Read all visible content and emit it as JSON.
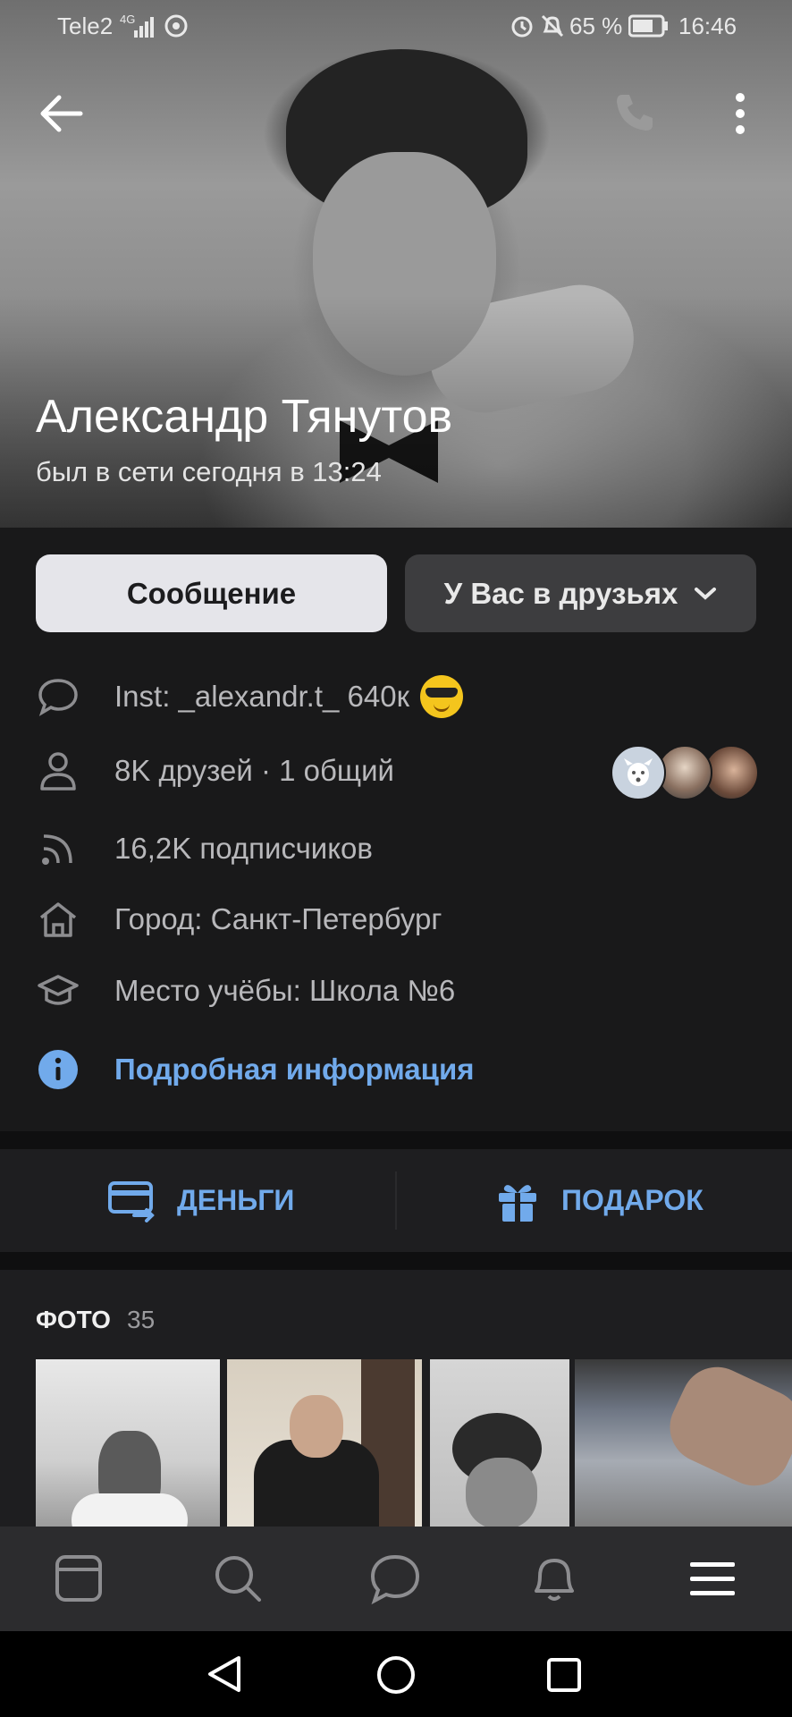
{
  "status_bar": {
    "carrier": "Tele2",
    "network": "4G",
    "battery": "65 %",
    "time": "16:46"
  },
  "toolbar": {
    "back_icon": "arrow-left-icon",
    "call_icon": "phone-icon",
    "menu_icon": "more-vertical-icon"
  },
  "profile": {
    "name": "Александр Тянутов",
    "last_seen": "был в сети сегодня в 13:24"
  },
  "buttons": {
    "message": "Сообщение",
    "friends": "У Вас в друзьях"
  },
  "info": {
    "status": "Inst: _alexandr.t_ 640к",
    "status_emoji": "😎",
    "friends": "8K друзей · 1 общий",
    "followers": "16,2K подписчиков",
    "city": "Город: Санкт-Петербург",
    "school": "Место учёбы: Школа №6",
    "more": "Подробная информация"
  },
  "actions": {
    "money": "ДЕНЬГИ",
    "gift": "ПОДАРОК"
  },
  "photos": {
    "title": "ФОТО",
    "count": "35"
  },
  "colors": {
    "background": "#19191a",
    "accent": "#71aaeb",
    "card": "#1e1e20",
    "secondary_button": "#3d3d3f"
  }
}
